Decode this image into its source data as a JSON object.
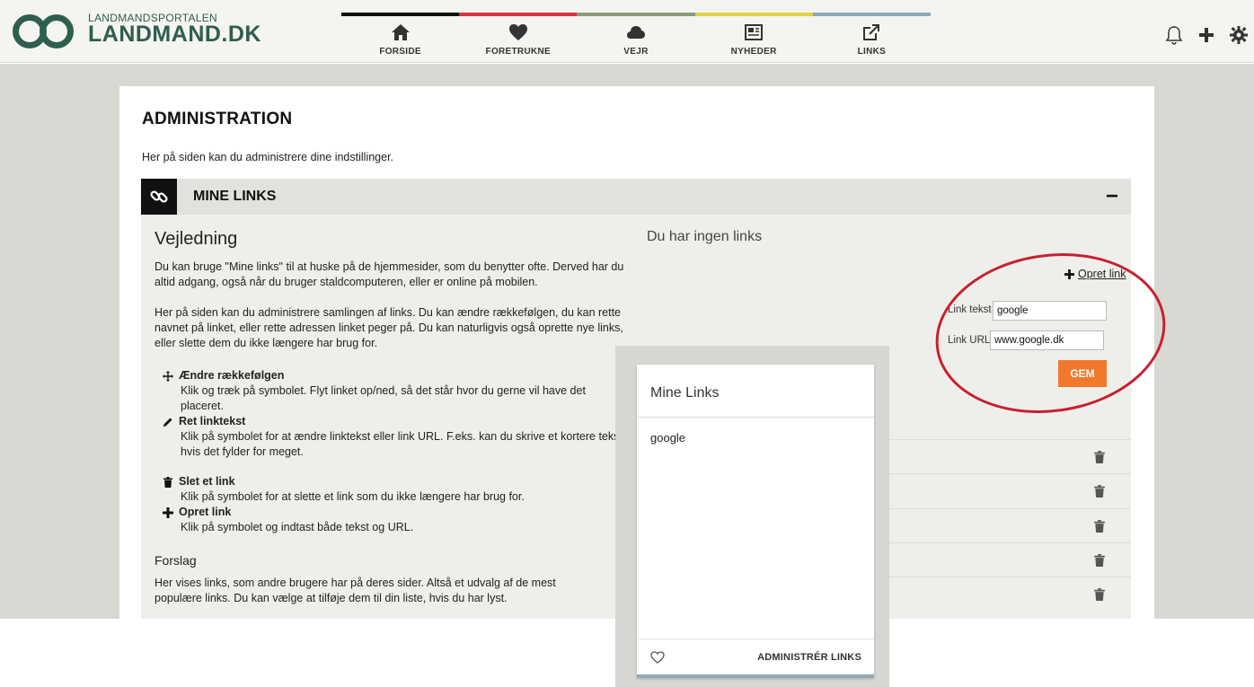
{
  "logo": {
    "small": "LANDMANDSPORTALEN",
    "big": "LANDMAND.DK"
  },
  "nav": [
    {
      "label": "FORSIDE",
      "icon": "home-icon",
      "color": "#111111"
    },
    {
      "label": "FORETRUKNE",
      "icon": "heart-icon",
      "color": "#d9333c"
    },
    {
      "label": "VEJR",
      "icon": "cloud-icon",
      "color": "#8c9a7c"
    },
    {
      "label": "NYHEDER",
      "icon": "newspaper-icon",
      "color": "#e0d24a"
    },
    {
      "label": "LINKS",
      "icon": "external-link-icon",
      "color": "#8cabb6"
    }
  ],
  "top_icons": [
    "bell-icon",
    "plus-icon",
    "gear-icon"
  ],
  "page": {
    "title": "ADMINISTRATION",
    "subtitle": "Her på siden kan du administrere dine indstillinger."
  },
  "section": {
    "title": "MINE LINKS",
    "collapse": "−"
  },
  "guide": {
    "title": "Vejledning",
    "p1": "Du kan bruge \"Mine links\" til at huske på de hjemmesider, som du benytter ofte. Derved har du altid adgang, også når du bruger staldcomputeren, eller er online på mobilen.",
    "p2": "Her på siden kan du administrere samlingen af links. Du kan ændre rækkefølgen, du kan rette navnet på linket, eller rette adressen linket peger på. Du kan naturligvis også oprette nye links, eller slette dem du ikke længere har brug for.",
    "tips": [
      {
        "head": "Ændre rækkefølgen",
        "text": "Klik og træk på symbolet. Flyt linket op/ned, så det står hvor du gerne vil have det placeret.",
        "icon": "move-icon"
      },
      {
        "head": "Ret linktekst",
        "text": "Klik på symbolet for at ændre linktekst eller link URL. F.eks. kan du skrive et kortere tekst, hvis det fylder for meget.",
        "icon": "pencil-icon"
      },
      {
        "head": "Slet et link",
        "text": "Klik på symbolet for at slette et link som du ikke længere har brug for.",
        "icon": "trash-icon"
      },
      {
        "head": "Opret link",
        "text": "Klik på symbolet og indtast både tekst og URL.",
        "icon": "plus-icon"
      }
    ],
    "suggest_title": "Forslag",
    "suggest_text": "Her vises links, som andre brugere har på deres sider. Altså et udvalg af de mest populære links. Du kan vælge at tilføje dem til din liste, hvis du har lyst."
  },
  "links_panel": {
    "empty_text": "Du har ingen links",
    "create_label": "Opret link",
    "text_label": "Link tekst",
    "text_value": "google",
    "url_label": "Link URL",
    "url_value": "www.google.dk",
    "save_label": "GEM"
  },
  "popup": {
    "title": "Mine Links",
    "items": [
      "google"
    ],
    "admin_label": "ADMINISTRÉR LINKS"
  },
  "colors": {
    "accent": "#f0792d",
    "highlight": "#c8202f",
    "brand": "#2e5e4e"
  }
}
